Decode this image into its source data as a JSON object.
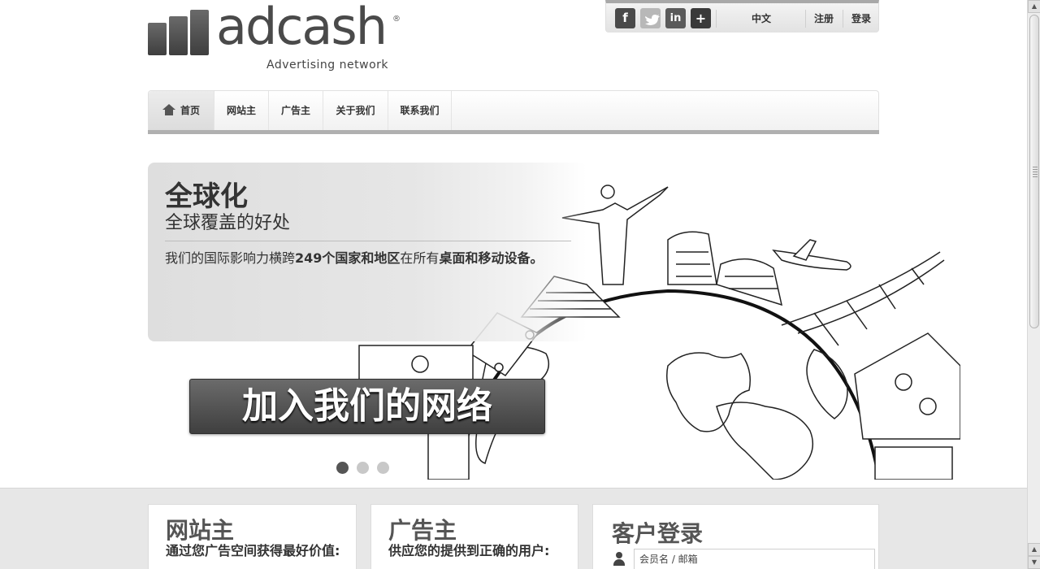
{
  "logo": {
    "word": "adcash",
    "registered": "®",
    "tagline": "Advertising network"
  },
  "topbar": {
    "social": [
      {
        "icon": "facebook-icon",
        "glyph": "f"
      },
      {
        "icon": "twitter-icon",
        "glyph": "🐦"
      },
      {
        "icon": "linkedin-icon",
        "glyph": "in"
      },
      {
        "icon": "google-plus-icon",
        "glyph": "+"
      }
    ],
    "language": "中文",
    "register": "注册",
    "login": "登录"
  },
  "nav": {
    "items": [
      "首页",
      "网站主",
      "广告主",
      "关于我们",
      "联系我们"
    ],
    "active_index": 0
  },
  "hero": {
    "title": "全球化",
    "subtitle": "全球覆盖的好处",
    "text_parts": [
      "我们的国际影响力横跨",
      "249个国家和地区",
      "在所有",
      "桌面和移动设备",
      "。"
    ],
    "join_button": "加入我们的网络",
    "slides": 3,
    "active_slide": 0
  },
  "publishers": {
    "title": "网站主",
    "subtitle": "通过您广告空间获得最好价值:"
  },
  "advertisers": {
    "title": "广告主",
    "subtitle": "供应您的提供到正确的用户:"
  },
  "login": {
    "title": "客户登录",
    "username_placeholder": "会员名 / 邮箱"
  },
  "colors": {
    "dark": "#3f3f3f",
    "accent_gray": "#b0b0b0",
    "band": "#e7e7e7"
  }
}
